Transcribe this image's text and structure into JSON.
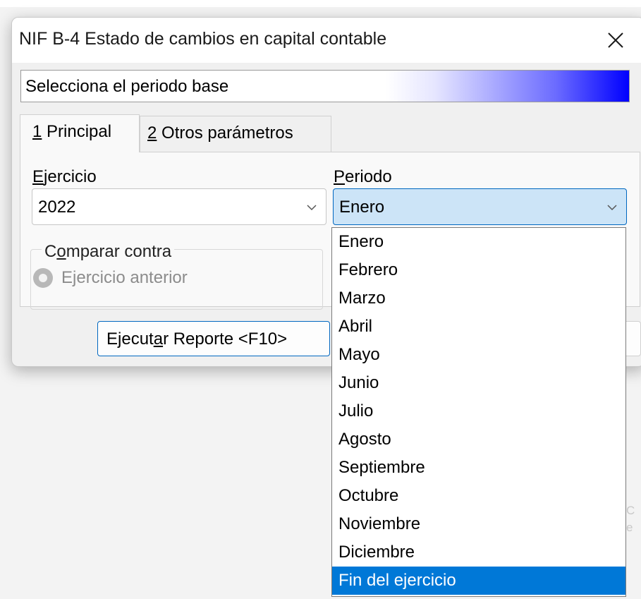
{
  "window": {
    "title": "NIF B-4 Estado de cambios en capital contable"
  },
  "banner": {
    "text": "Selecciona el periodo base",
    "gradient_colors": [
      "#ffffff",
      "#0000ff"
    ]
  },
  "tabs": [
    {
      "mnemonic": "1",
      "label": " Principal",
      "active": true
    },
    {
      "mnemonic": "2",
      "label": " Otros parámetros",
      "active": false
    }
  ],
  "ejercicio": {
    "label_mnemonic": "E",
    "label_rest": "jercicio",
    "value": "2022"
  },
  "periodo": {
    "label_mnemonic": "P",
    "label_rest": "eriodo",
    "value": "Enero",
    "options": [
      "Enero",
      "Febrero",
      "Marzo",
      "Abril",
      "Mayo",
      "Junio",
      "Julio",
      "Agosto",
      "Septiembre",
      "Octubre",
      "Noviembre",
      "Diciembre",
      "Fin del ejercicio"
    ],
    "highlighted_option": "Fin del ejercicio"
  },
  "comparar": {
    "title_pre": "C",
    "title_mnemonic": "o",
    "title_rest": "mparar contra",
    "radio_label": "Ejercicio anterior",
    "enabled": false
  },
  "buttons": {
    "execute_pre": "Ejecut",
    "execute_mnemonic": "a",
    "execute_rest": "r Reporte <F10>"
  },
  "background_fragments": [
    "C",
    "e"
  ],
  "colors": {
    "accent": "#0067c0",
    "selection": "#0078d7",
    "combo_focus": "#cce4f7"
  }
}
